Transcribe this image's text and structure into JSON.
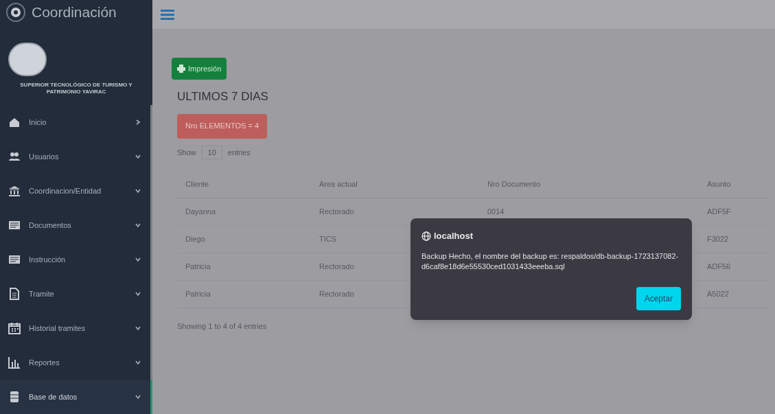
{
  "sidebar": {
    "title": "Coordinación",
    "institution": "SUPERIOR TECNOLÓGICO DE TURISMO Y PATRIMONIO YAVIRAC",
    "items": [
      {
        "label": "Inicio",
        "kind": "link",
        "selected": false
      },
      {
        "label": "Usuarios",
        "kind": "group",
        "selected": false
      },
      {
        "label": "Coordinacion/Entidad",
        "kind": "group",
        "selected": false
      },
      {
        "label": "Documentos",
        "kind": "group",
        "selected": false
      },
      {
        "label": "Instrucción",
        "kind": "group",
        "selected": false
      },
      {
        "label": "Tramite",
        "kind": "group",
        "selected": false
      },
      {
        "label": "Historial tramites",
        "kind": "group",
        "selected": false
      },
      {
        "label": "Reportes",
        "kind": "group",
        "selected": false
      },
      {
        "label": "Base de datos",
        "kind": "group",
        "selected": true
      }
    ]
  },
  "print_button": "Impresión",
  "heading": "ULTIMOS 7 DIAS",
  "count_button": "Nro ELEMENTOS = 4",
  "length": {
    "before": "Show",
    "value": "10",
    "after": "entries"
  },
  "table": {
    "columns": [
      "Cliente",
      "Area actual",
      "Nro Documento",
      "Asunto"
    ],
    "rows": [
      [
        "Dayanna",
        "Rectorado",
        "0014",
        "ADF5F"
      ],
      [
        "Diego",
        "TICS",
        "",
        "F3022"
      ],
      [
        "Patricia",
        "Rectorado",
        "",
        "ADF56"
      ],
      [
        "Patricia",
        "Rectorado",
        "",
        "A5022"
      ]
    ]
  },
  "info": "Showing 1 to 4 of 4 entries",
  "dialog": {
    "origin": "localhost",
    "message": "Backup Hecho, el nombre del backup es: respaldos/db-backup-1723137082-d6caf8e18d6e55530ced1031433eeeba.sql",
    "button": "Aceptar"
  }
}
